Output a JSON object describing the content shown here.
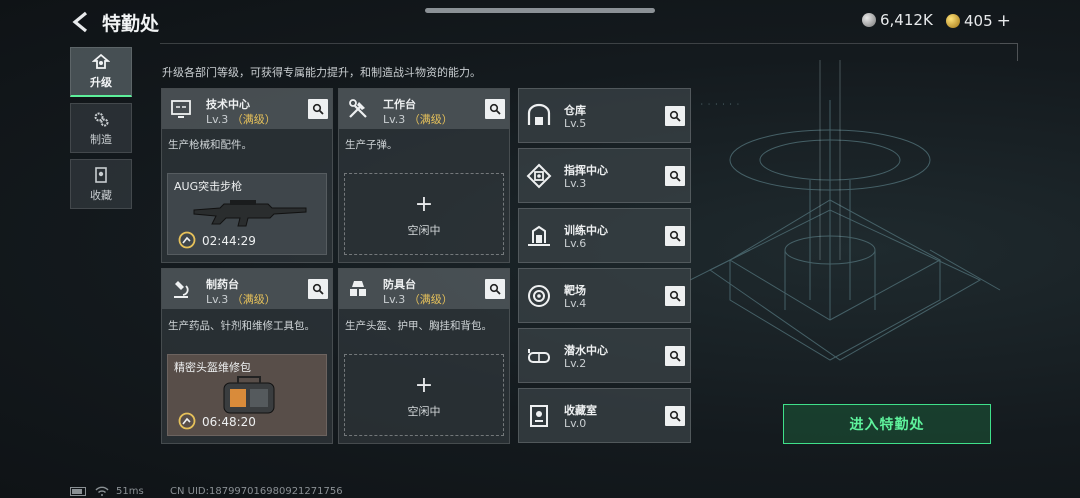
{
  "header": {
    "title": "特勤处",
    "currency_silver": "6,412K",
    "currency_gold": "405",
    "plus_label": "+"
  },
  "sidebar": {
    "items": [
      {
        "label": "升级",
        "icon": "upgrade-icon",
        "active": true
      },
      {
        "label": "制造",
        "icon": "gear-cluster-icon",
        "active": false
      },
      {
        "label": "收藏",
        "icon": "collection-icon",
        "active": false
      }
    ]
  },
  "subtitle": "升级各部门等级，可获得专属能力提升，和制造战斗物资的能力。",
  "workshops": [
    {
      "name": "技术中心",
      "level": "Lv.3",
      "max_label": "（满级）",
      "desc": "生产枪械和配件。",
      "producing": {
        "item": "AUG突击步枪",
        "time": "02:44:29"
      },
      "icon": "monitor-icon"
    },
    {
      "name": "工作台",
      "level": "Lv.3",
      "max_label": "（满级）",
      "desc": "生产子弹。",
      "idle": {
        "plus": "+",
        "label": "空闲中"
      },
      "icon": "tools-icon"
    },
    {
      "name": "制药台",
      "level": "Lv.3",
      "max_label": "（满级）",
      "desc": "生产药品、针剂和维修工具包。",
      "producing": {
        "item": "精密头盔维修包",
        "time": "06:48:20"
      },
      "icon": "microscope-icon"
    },
    {
      "name": "防具台",
      "level": "Lv.3",
      "max_label": "（满级）",
      "desc": "生产头盔、护甲、胸挂和背包。",
      "idle": {
        "plus": "+",
        "label": "空闲中"
      },
      "icon": "armor-icon"
    }
  ],
  "facilities": [
    {
      "name": "仓库",
      "level": "Lv.5",
      "icon": "warehouse-icon"
    },
    {
      "name": "指挥中心",
      "level": "Lv.3",
      "icon": "command-icon"
    },
    {
      "name": "训练中心",
      "level": "Lv.6",
      "icon": "training-icon"
    },
    {
      "name": "靶场",
      "level": "Lv.4",
      "icon": "target-icon"
    },
    {
      "name": "潜水中心",
      "level": "Lv.2",
      "icon": "diving-icon"
    },
    {
      "name": "收藏室",
      "level": "Lv.0",
      "icon": "collection-room-icon"
    }
  ],
  "enter_button": "进入特勤处",
  "status_bar": {
    "ping": "51ms",
    "uid": "CN UID:1879970169809212717​56"
  },
  "colors": {
    "accent_green": "#5ef29c",
    "max_level_gold": "#e6c15a"
  }
}
